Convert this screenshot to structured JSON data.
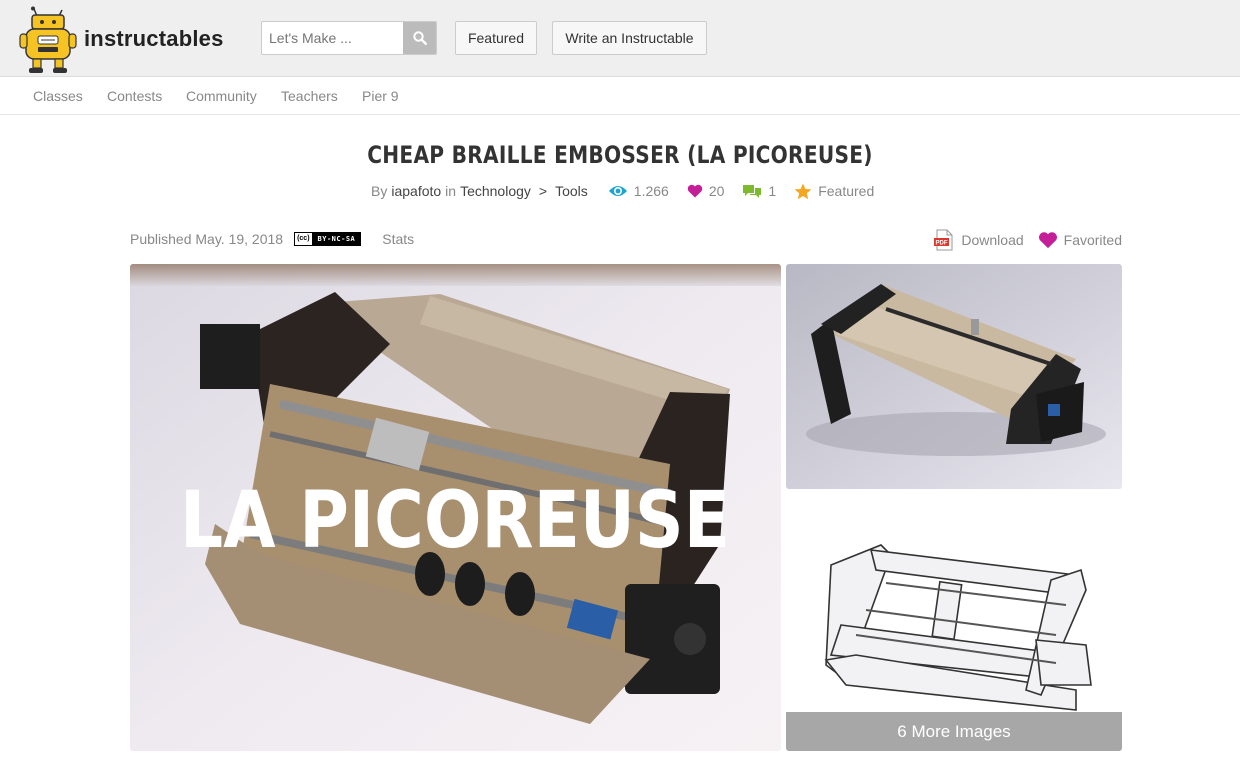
{
  "brand": {
    "name": "instructables",
    "logo_icon": "robot-mascot-icon"
  },
  "search": {
    "placeholder": "Let's Make ...",
    "icon": "search-icon"
  },
  "header_buttons": {
    "featured": "Featured",
    "write": "Write an Instructable"
  },
  "subnav": [
    "Classes",
    "Contests",
    "Community",
    "Teachers",
    "Pier 9"
  ],
  "project": {
    "title": "CHEAP BRAILLE EMBOSSER (LA PICOREUSE)",
    "by_label": "By",
    "author": "iapafoto",
    "in_label": "in",
    "category": "Technology",
    "separator": ">",
    "subcategory": "Tools",
    "views": "1.266",
    "favorites": "20",
    "comments": "1",
    "featured_label": "Featured"
  },
  "meta": {
    "published": "Published May. 19, 2018",
    "license_cc": "(cc)",
    "license_type": "BY-NC-SA",
    "stats": "Stats",
    "download": "Download",
    "favorited": "Favorited"
  },
  "gallery": {
    "main_overlay_text": "LA PICOREUSE",
    "more_images": "6 More Images"
  },
  "colors": {
    "accent_view": "#1ea4d2",
    "accent_heart": "#c41e99",
    "accent_comment": "#7dbb2c",
    "accent_star": "#f5a623",
    "pdf_red": "#d83a2e"
  }
}
